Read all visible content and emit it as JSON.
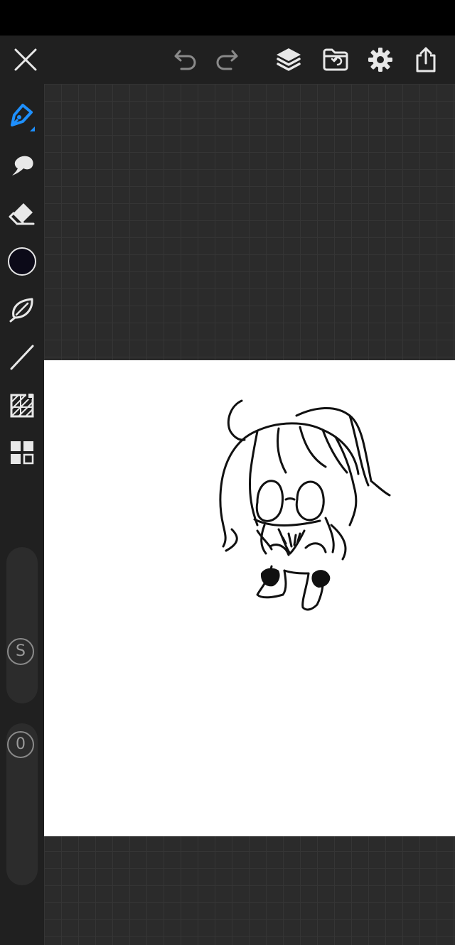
{
  "top_toolbar": {
    "close": "close-icon",
    "undo": "undo-icon",
    "redo": "redo-icon",
    "layers": "layers-icon",
    "gallery": "gallery-folder-icon",
    "settings": "gear-icon",
    "share": "share-icon"
  },
  "left_toolbar": {
    "tools": [
      "pen-icon",
      "smudge-icon",
      "eraser-icon",
      "color-swatch",
      "lasso-icon",
      "line-icon",
      "fill-pattern-icon",
      "grid-layout-icon"
    ],
    "colors": {
      "active_tool": "#1e90ff",
      "current_color": "#0c0a18",
      "icon": "#e8e8e8"
    },
    "size_slider": {
      "label": "S"
    },
    "opacity_slider": {
      "label": "0"
    }
  },
  "canvas": {
    "background": "#ffffff"
  }
}
